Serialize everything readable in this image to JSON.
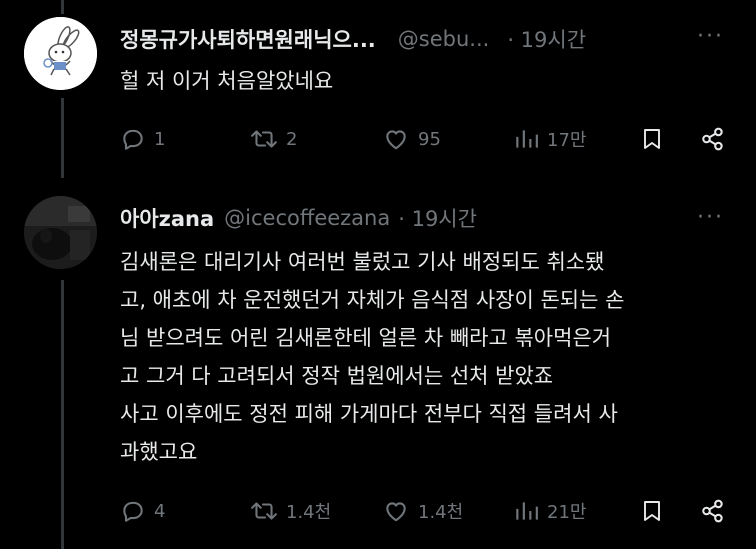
{
  "tweet1": {
    "author_name": "정몽규가사퇴하면원래닉으...",
    "handle": "@sebu...",
    "time": "· 19시간",
    "more": "···",
    "text": "헐 저 이거 처음알았네요",
    "actions": {
      "reply_count": "1",
      "retweet_count": "2",
      "like_count": "95",
      "views_count": "17만"
    }
  },
  "tweet2": {
    "author_name": "아아zana",
    "handle": "@icecoffeezana",
    "time": "· 19시간",
    "more": "···",
    "text_lines": [
      "김새론은 대리기사 여러번 불렀고 기사 배정되도 취소됐",
      "고, 애초에 차 운전했던거 자체가 음식점 사장이 돈되는 손",
      "님 받으려도 어린 김새론한테 얼른 차 빼라고 볶아먹은거",
      "고 그거 다 고려되서 정작 법원에서는 선처 받았죠",
      "사고 이후에도 정전 피해 가게마다 전부다 직접 들려서 사",
      "과했고요"
    ],
    "actions": {
      "reply_count": "4",
      "retweet_count": "1.4천",
      "like_count": "1.4천",
      "views_count": "21만"
    }
  },
  "colors": {
    "background": "#000000",
    "text": "#e7e9ea",
    "muted": "#71767b",
    "thread_line": "#333639"
  }
}
